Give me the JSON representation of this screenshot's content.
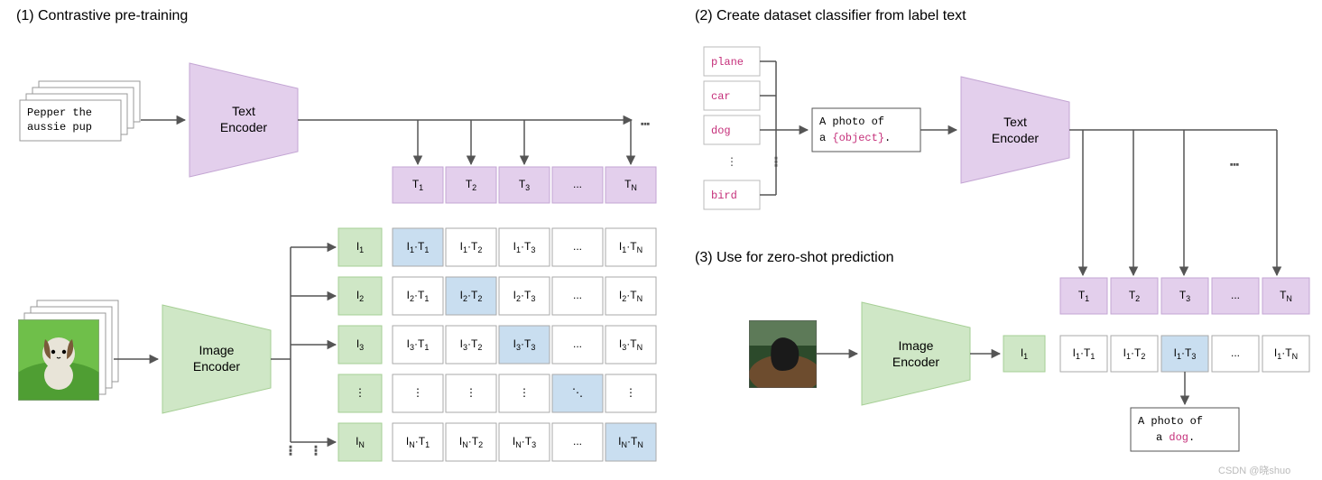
{
  "titles": {
    "panel1": "(1) Contrastive pre-training",
    "panel2": "(2) Create dataset classifier from label text",
    "panel3": "(3) Use for zero-shot prediction"
  },
  "textCaption1": "Pepper the",
  "textCaption2": "aussie pup",
  "textEncoder1": "Text",
  "textEncoder2": "Encoder",
  "imageEncoder1": "Image",
  "imageEncoder2": "Encoder",
  "labels": {
    "plane": "plane",
    "car": "car",
    "dog": "dog",
    "bird": "bird"
  },
  "prompt1": "A photo of",
  "prompt2a": "a ",
  "prompt2b": "{object}",
  "prompt2c": ".",
  "result1": "A photo of",
  "result2a": "a ",
  "result2b": "dog",
  "result2c": ".",
  "ellipsis": "...",
  "vellip": "⋮",
  "ddots": "⋱",
  "T": "T",
  "I": "I",
  "N": "N",
  "dot": "·",
  "n1": "1",
  "n2": "2",
  "n3": "3",
  "watermark": "CSDN @晓shuo"
}
